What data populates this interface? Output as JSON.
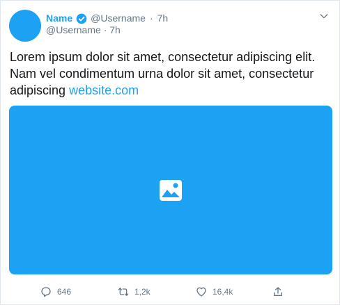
{
  "tweet": {
    "name": "Name",
    "username": "@Username",
    "time": "7h",
    "meta_dot": "·",
    "body_text": "Lorem ipsum dolor sit amet, consectetur adipiscing elit. Nam vel condimentum urna dolor sit amet, consectetur adipiscing ",
    "link_text": "website.com"
  },
  "actions": {
    "reply_count": "646",
    "retweet_count": "1,2k",
    "like_count": "16,4k"
  },
  "icons": {
    "verified": "verified-badge-icon",
    "more": "chevron-down-icon",
    "media": "image-icon",
    "reply": "reply-icon",
    "retweet": "retweet-icon",
    "like": "heart-icon",
    "share": "share-icon"
  },
  "colors": {
    "accent": "#1da1f2",
    "text": "#14171a",
    "muted": "#657786",
    "border": "#e1e8ed"
  }
}
